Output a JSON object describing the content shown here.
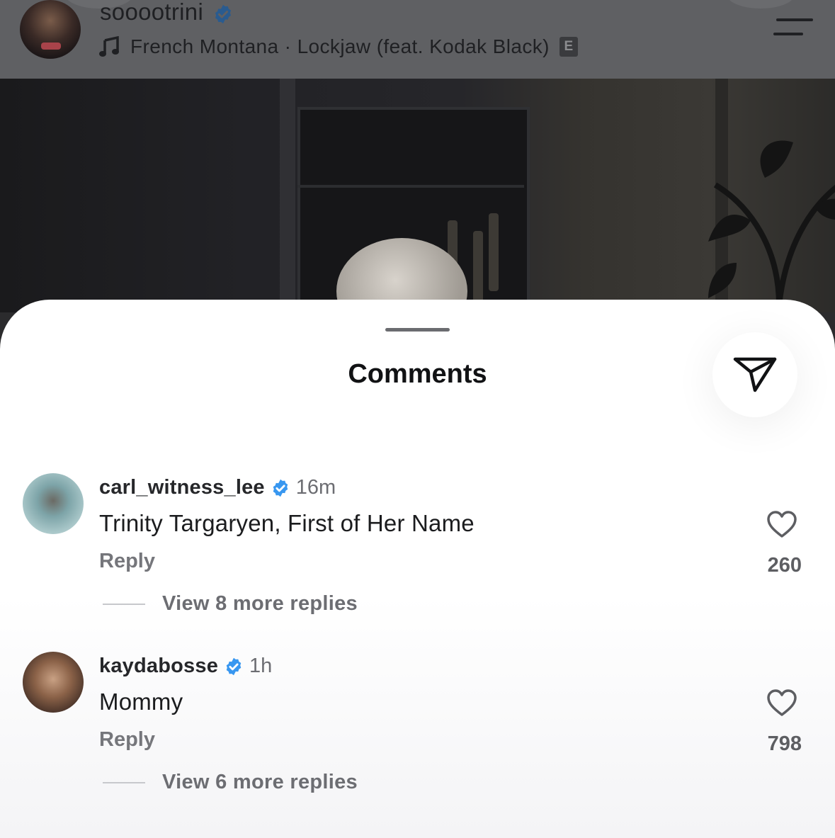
{
  "post": {
    "username": "sooootrini",
    "music": "French Montana · Lockjaw (feat. Kodak Black)",
    "explicit_badge": "E"
  },
  "sheet": {
    "title": "Comments"
  },
  "comments": [
    {
      "username": "carl_witness_lee",
      "time": "16m",
      "text": "Trinity Targaryen, First of Her Name",
      "reply_label": "Reply",
      "likes": "260",
      "more_replies": "View 8 more replies"
    },
    {
      "username": "kaydabosse",
      "time": "1h",
      "text": "Mommy",
      "reply_label": "Reply",
      "likes": "798",
      "more_replies": "View 6 more replies"
    }
  ],
  "icons": {
    "verified": "verified-badge-icon",
    "music": "music-note-icon",
    "share": "send-icon",
    "like": "heart-icon",
    "menu": "menu-icon"
  },
  "colors": {
    "verified_blue": "#3897f0",
    "header_dim": "#5f6063"
  }
}
